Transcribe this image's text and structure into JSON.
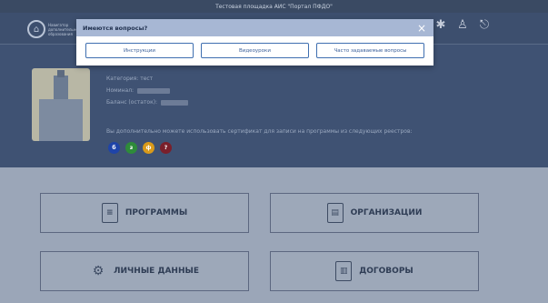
{
  "topbar": {
    "title": "Тестовая площадка АИС \"Портал ПФДО\""
  },
  "logo": {
    "text": "Навигатор дополнительного образования"
  },
  "profile": {
    "category_label": "Категория: тест",
    "nominal_label": "Номинал:",
    "balance_label": "Баланс (остаток):",
    "registry_note": "Вы дополнительно можете использовать сертификат для записи на программы из следующих реестров:",
    "registries": [
      {
        "label": "б",
        "color": "#1f44a8"
      },
      {
        "label": "з",
        "color": "#2e8b3a"
      },
      {
        "label": "ф",
        "color": "#d99a1a"
      },
      {
        "label": "?",
        "color": "#7a1f2b"
      }
    ]
  },
  "tiles": {
    "programs": "ПРОГРАММЫ",
    "organizations": "ОРГАНИЗАЦИИ",
    "personal_data": "ЛИЧНЫЕ ДАННЫЕ",
    "contracts": "ДОГОВОРЫ"
  },
  "modal": {
    "title": "Имеются вопросы?",
    "close": "×",
    "buttons": {
      "instructions": "Инструкции",
      "video_lessons": "Видеоуроки",
      "faq": "Часто задаваемые вопросы"
    }
  },
  "header_icons": [
    "snowflake-icon",
    "user-icon",
    "logout-icon"
  ]
}
